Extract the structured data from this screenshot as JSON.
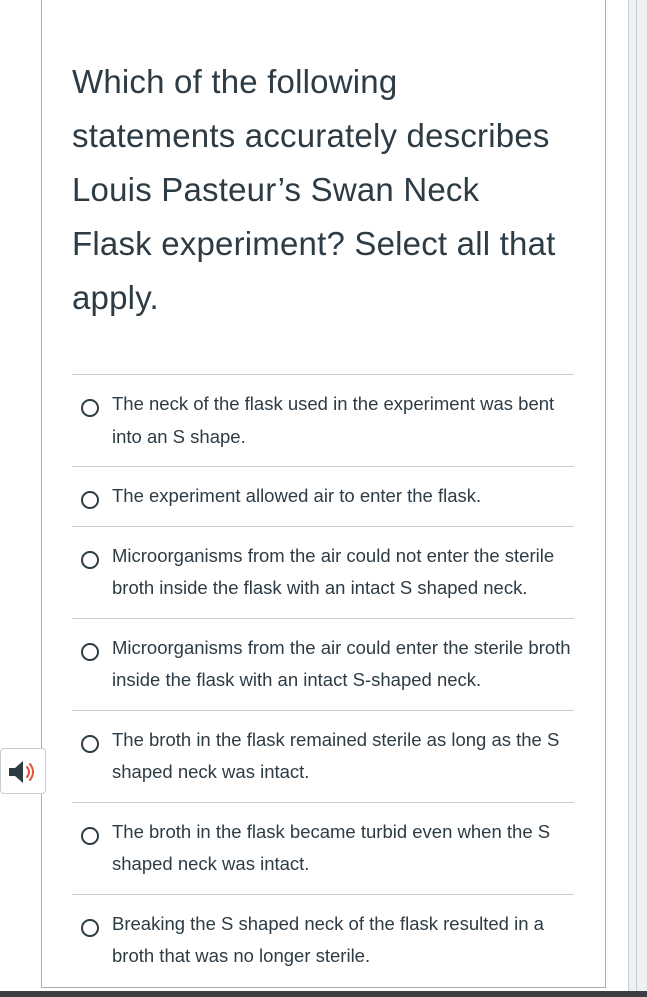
{
  "question": {
    "lines": [
      "Which of the following",
      "statements accurately describes",
      "Louis Pasteur’s Swan Neck",
      "Flask experiment? Select all that",
      "apply."
    ]
  },
  "answers": [
    {
      "text": "The neck of the flask used in the experiment was bent into an S shape."
    },
    {
      "text": "The experiment allowed air to enter the flask."
    },
    {
      "text": "Microorganisms from the air could not enter the sterile broth inside the flask with an intact S shaped neck."
    },
    {
      "text": "Microorganisms from the air could enter the sterile broth inside the flask with an intact S-shaped neck."
    },
    {
      "text": "The broth in the flask remained sterile as long as the S shaped neck was intact."
    },
    {
      "text": "The broth in the flask became turbid even when the S shaped neck was intact."
    },
    {
      "text": "Breaking the S shaped neck of the flask resulted in a broth that was no longer sterile."
    }
  ],
  "icons": {
    "read_aloud": "speaker-icon"
  },
  "colors": {
    "text": "#2d3b45",
    "divider": "#c7cdd1",
    "speaker_accent": "#e0533a"
  }
}
